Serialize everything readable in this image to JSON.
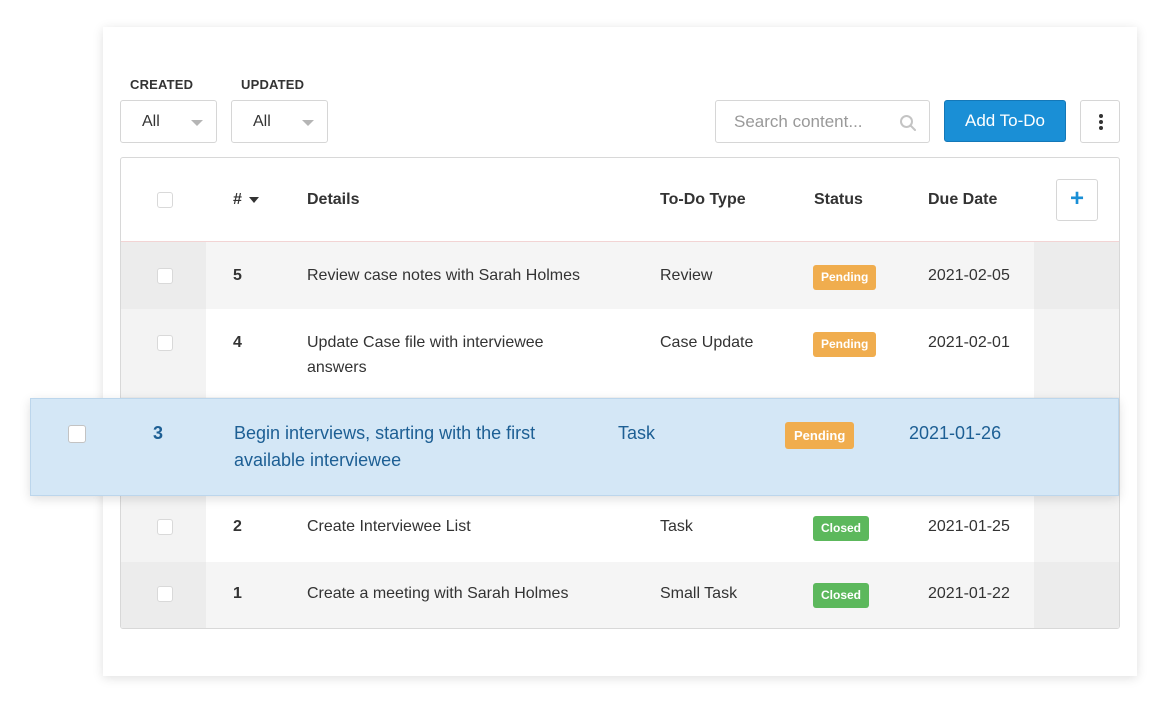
{
  "filters": {
    "created_label": "CREATED",
    "created_value": "All",
    "updated_label": "UPDATED",
    "updated_value": "All"
  },
  "search": {
    "placeholder": "Search content..."
  },
  "toolbar": {
    "add_label": "Add To-Do"
  },
  "table": {
    "columns": {
      "number": "#",
      "details": "Details",
      "type": "To-Do Type",
      "status": "Status",
      "due": "Due Date",
      "add_column": "+"
    },
    "rows": [
      {
        "number": "5",
        "details": "Review case notes with Sarah Holmes",
        "type": "Review",
        "status": "Pending",
        "due": "2021-02-05"
      },
      {
        "number": "4",
        "details": "Update Case file with interviewee answers",
        "type": "Case Update",
        "status": "Pending",
        "due": "2021-02-01"
      },
      {
        "number": "3",
        "details": "Begin interviews, starting with the first available interviewee",
        "type": "Task",
        "status": "Pending",
        "due": "2021-01-26"
      },
      {
        "number": "2",
        "details": "Create Interviewee List",
        "type": "Task",
        "status": "Closed",
        "due": "2021-01-25"
      },
      {
        "number": "1",
        "details": "Create a meeting with Sarah Holmes",
        "type": "Small Task",
        "status": "Closed",
        "due": "2021-01-22"
      }
    ]
  },
  "colors": {
    "accent": "#1a8fd6",
    "pending": "#f0ad4e",
    "closed": "#5cb85c",
    "dragged_row": "#d4e7f6"
  },
  "icons": {
    "search": "magnifier-icon",
    "more": "vertical-dots-icon",
    "sort": "caret-down-icon"
  }
}
